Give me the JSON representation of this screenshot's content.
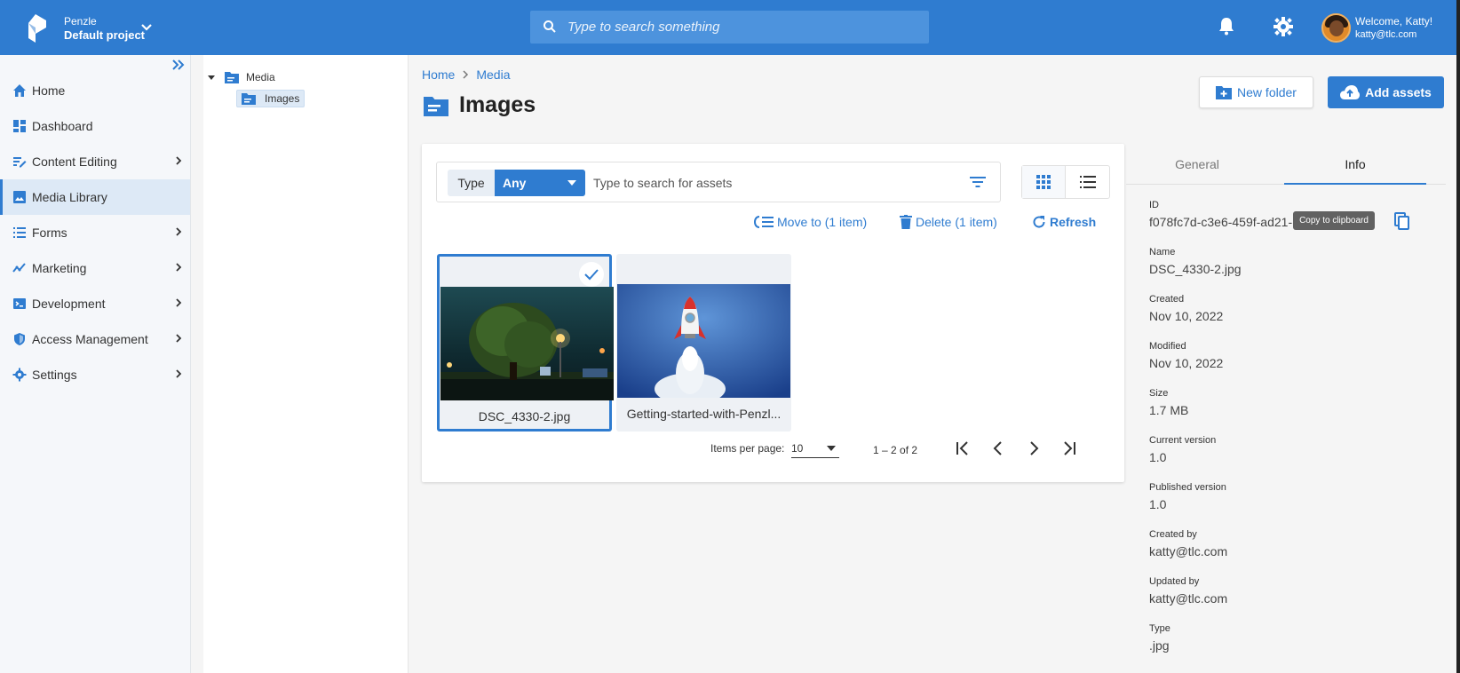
{
  "header": {
    "org": "Penzle",
    "project": "Default project",
    "search_placeholder": "Type to search something",
    "welcome": "Welcome, Katty!",
    "email": "katty@tlc.com",
    "logo_icon": "penzle-logo-icon",
    "bell_icon": "bell-icon",
    "gear_icon": "gear-icon"
  },
  "sidebar": {
    "items": [
      {
        "label": "Home",
        "icon": "home-icon"
      },
      {
        "label": "Dashboard",
        "icon": "dashboard-icon"
      },
      {
        "label": "Content Editing",
        "icon": "edit-icon"
      },
      {
        "label": "Media Library",
        "icon": "image-icon"
      },
      {
        "label": "Forms",
        "icon": "list-icon"
      },
      {
        "label": "Marketing",
        "icon": "trend-icon"
      },
      {
        "label": "Development",
        "icon": "terminal-icon"
      },
      {
        "label": "Access Management",
        "icon": "shield-icon"
      },
      {
        "label": "Settings",
        "icon": "gear-icon"
      }
    ],
    "active": "Media Library"
  },
  "tree": {
    "root": "Media",
    "child": "Images"
  },
  "main": {
    "breadcrumb": [
      "Home",
      "Media"
    ],
    "title": "Images",
    "new_folder": "New folder",
    "add_assets": "Add assets",
    "filter": {
      "type_label": "Type",
      "type_value": "Any",
      "search_placeholder": "Type to search for assets"
    },
    "actions": {
      "move": "Move to (1 item)",
      "delete": "Delete (1 item)",
      "refresh": "Refresh"
    },
    "assets": [
      {
        "name": "DSC_4330-2.jpg",
        "selected": true
      },
      {
        "name": "Getting-started-with-Penzl...",
        "selected": false
      }
    ],
    "pagination": {
      "items_per_page_label": "Items per page:",
      "items_per_page": "10",
      "range": "1 – 2 of 2"
    }
  },
  "details": {
    "tabs": [
      "General",
      "Info"
    ],
    "active_tab": "Info",
    "tooltip": "Copy to clipboard",
    "fields": [
      {
        "label": "ID",
        "value": "f078fc7d-c3e6-459f-ad21-"
      },
      {
        "label": "Name",
        "value": "DSC_4330-2.jpg"
      },
      {
        "label": "Created",
        "value": "Nov 10, 2022"
      },
      {
        "label": "Modified",
        "value": "Nov 10, 2022"
      },
      {
        "label": "Size",
        "value": "1.7 MB"
      },
      {
        "label": "Current version",
        "value": "1.0"
      },
      {
        "label": "Published version",
        "value": "1.0"
      },
      {
        "label": "Created by",
        "value": "katty@tlc.com"
      },
      {
        "label": "Updated by",
        "value": "katty@tlc.com"
      },
      {
        "label": "Type",
        "value": ".jpg"
      }
    ]
  },
  "colors": {
    "primary": "#2f7cd0",
    "header": "#2f7cd0",
    "active_nav": "#dde9f6"
  }
}
